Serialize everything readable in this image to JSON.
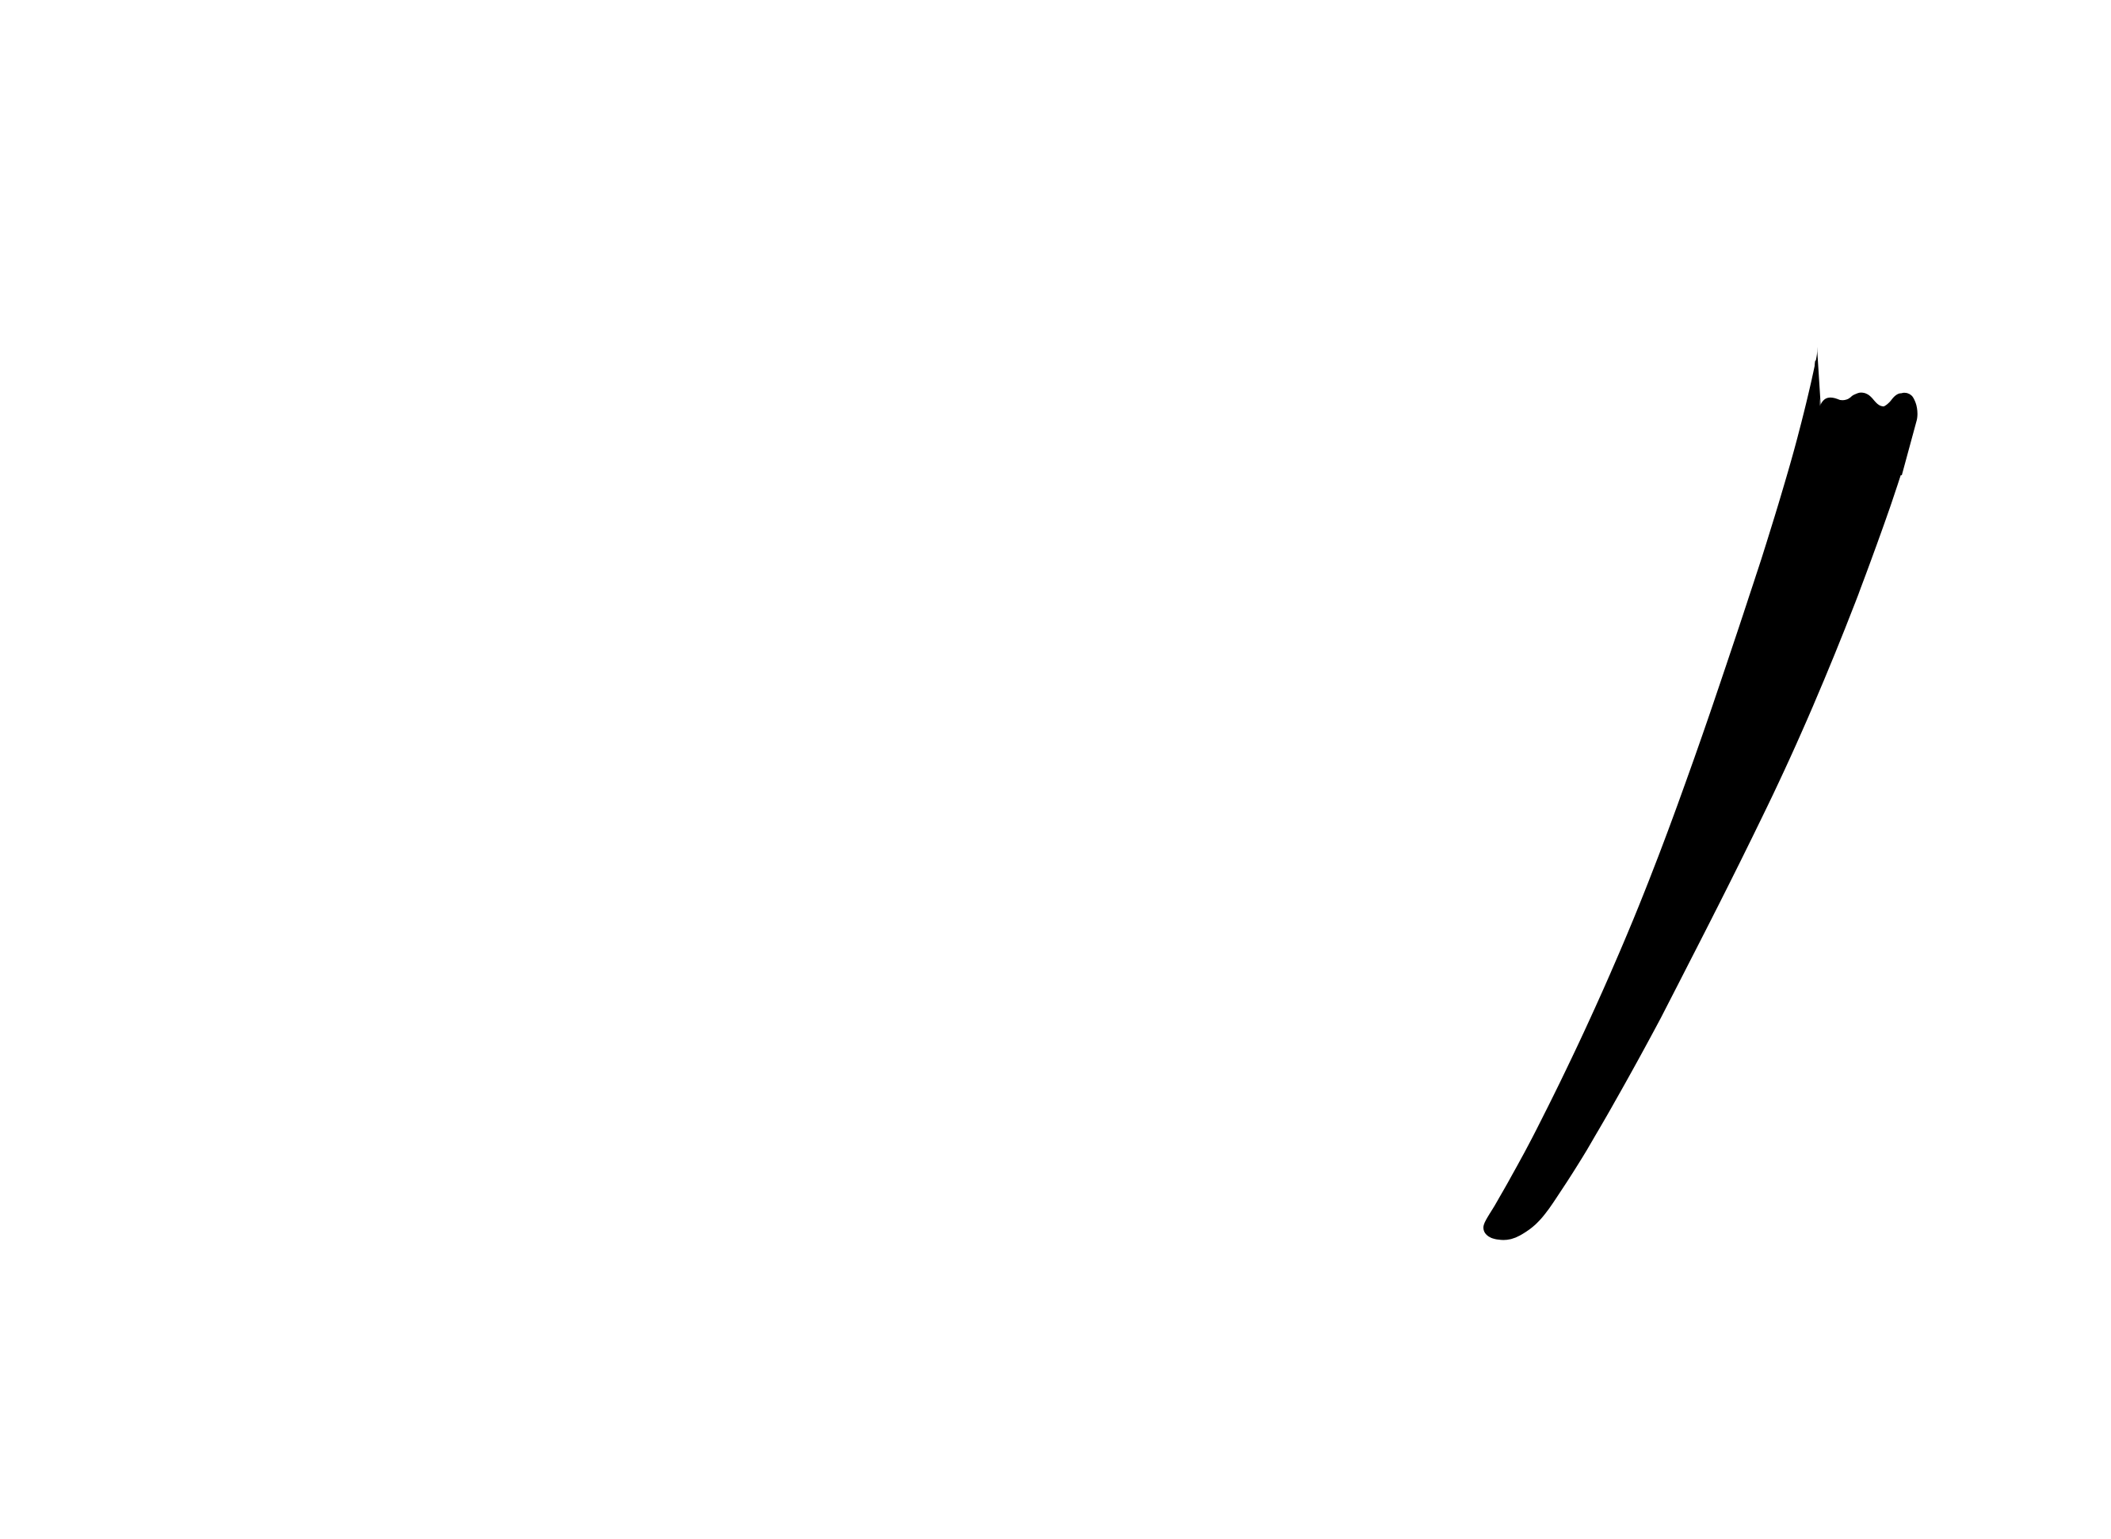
{
  "canvas": {
    "background_color": "#ffffff"
  },
  "stroke": {
    "description_icon": "brush-stroke-mark",
    "color": "#000000"
  }
}
